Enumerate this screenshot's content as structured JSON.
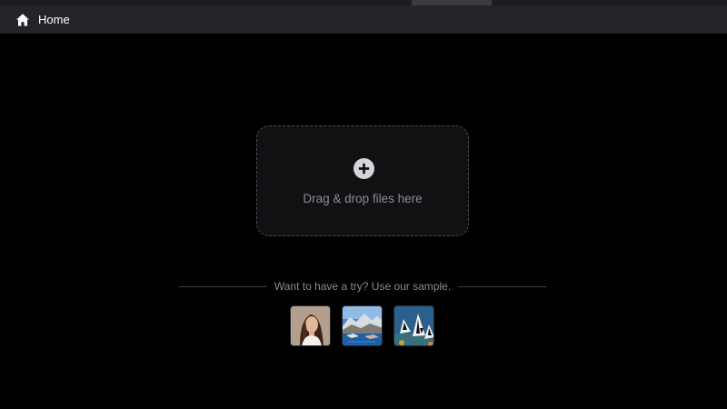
{
  "nav": {
    "home_label": "Home",
    "home_icon": "home-icon"
  },
  "upload": {
    "icon": "plus-circle-icon",
    "drop_text": "Drag & drop files here"
  },
  "samples": {
    "hint": "Want to have a try? Use our sample.",
    "items": [
      {
        "icon": "portrait-thumbnail"
      },
      {
        "icon": "coast-landscape-thumbnail"
      },
      {
        "icon": "fish-thumbnail"
      }
    ]
  },
  "colors": {
    "background": "#000000",
    "navbar": "#242428",
    "dropzone_bg": "#111113",
    "dropzone_border": "#4a4a52",
    "text_muted": "#8c8c94"
  }
}
